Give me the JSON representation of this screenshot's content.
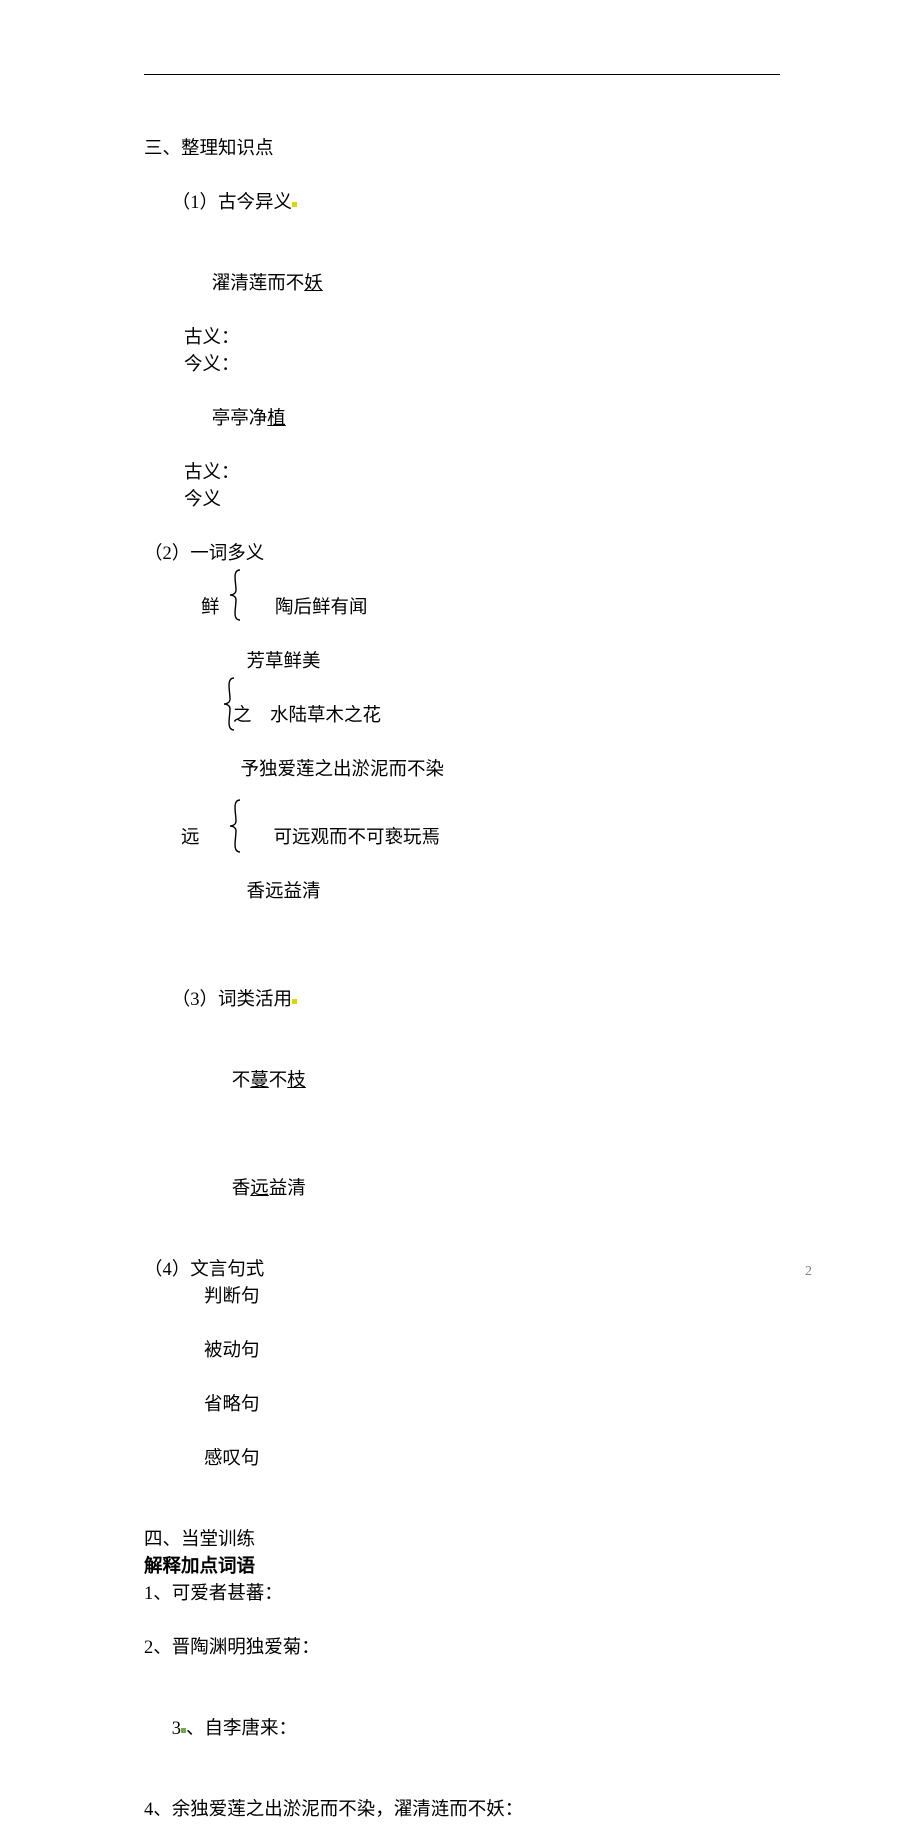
{
  "section3": {
    "heading": "三、整理知识点",
    "s1": {
      "title": "（1）古今异义",
      "ex1": {
        "pre": "濯清莲而不",
        "u": "妖"
      },
      "gu": "古义：",
      "jin": "今义：",
      "ex2": {
        "pre": "亭亭净",
        "u": "植"
      },
      "gu2": "古义：",
      "jin2": "今义"
    },
    "s2": {
      "title": "（2）一词多义",
      "xian": {
        "label": "鲜",
        "a": "陶后鲜有闻",
        "b": "芳草鲜美"
      },
      "zhi": {
        "label": "之",
        "a": "水陆草木之花",
        "b": "予独爱莲之出淤泥而不染"
      },
      "yuan": {
        "label": "远",
        "a": "可远观而不可亵玩焉",
        "b": "香远益清"
      }
    },
    "s3": {
      "title": "（3）词类活用",
      "ex1": {
        "pre": "不",
        "u1": "蔓",
        "mid": "不",
        "u2": "枝"
      },
      "ex2": {
        "pre": "香",
        "u": "远",
        "post": "益清"
      }
    },
    "s4": {
      "title": "（4）文言句式",
      "items": [
        "判断句",
        "被动句",
        "省略句",
        "感叹句"
      ]
    }
  },
  "section4": {
    "heading": "四、当堂训练",
    "subheading": "解释加点词语",
    "q1": "1、可爱者甚蕃：",
    "q2": "2、晋陶渊明独爱菊：",
    "q3_pre": "3",
    "q3_rest": "、自李唐来：",
    "q4": "4、余独爱莲之出淤泥而不染，濯清涟而不妖："
  },
  "pageNumber": "2"
}
